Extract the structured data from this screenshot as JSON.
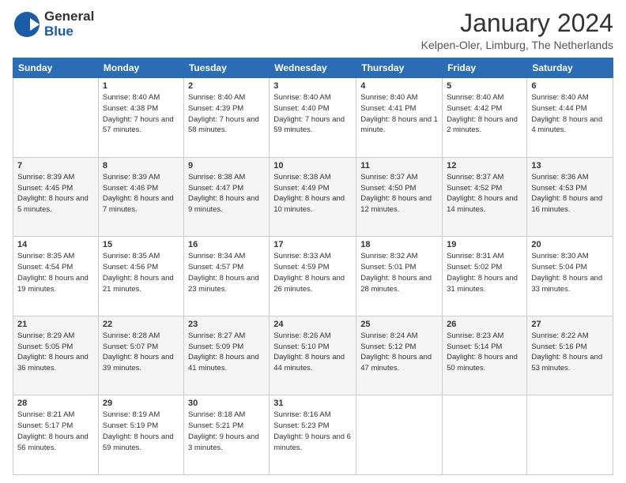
{
  "logo": {
    "general": "General",
    "blue": "Blue"
  },
  "header": {
    "month_year": "January 2024",
    "location": "Kelpen-Oler, Limburg, The Netherlands"
  },
  "columns": [
    "Sunday",
    "Monday",
    "Tuesday",
    "Wednesday",
    "Thursday",
    "Friday",
    "Saturday"
  ],
  "weeks": [
    [
      {
        "day": "",
        "sunrise": "",
        "sunset": "",
        "daylight": ""
      },
      {
        "day": "1",
        "sunrise": "Sunrise: 8:40 AM",
        "sunset": "Sunset: 4:38 PM",
        "daylight": "Daylight: 7 hours and 57 minutes."
      },
      {
        "day": "2",
        "sunrise": "Sunrise: 8:40 AM",
        "sunset": "Sunset: 4:39 PM",
        "daylight": "Daylight: 7 hours and 58 minutes."
      },
      {
        "day": "3",
        "sunrise": "Sunrise: 8:40 AM",
        "sunset": "Sunset: 4:40 PM",
        "daylight": "Daylight: 7 hours and 59 minutes."
      },
      {
        "day": "4",
        "sunrise": "Sunrise: 8:40 AM",
        "sunset": "Sunset: 4:41 PM",
        "daylight": "Daylight: 8 hours and 1 minute."
      },
      {
        "day": "5",
        "sunrise": "Sunrise: 8:40 AM",
        "sunset": "Sunset: 4:42 PM",
        "daylight": "Daylight: 8 hours and 2 minutes."
      },
      {
        "day": "6",
        "sunrise": "Sunrise: 8:40 AM",
        "sunset": "Sunset: 4:44 PM",
        "daylight": "Daylight: 8 hours and 4 minutes."
      }
    ],
    [
      {
        "day": "7",
        "sunrise": "Sunrise: 8:39 AM",
        "sunset": "Sunset: 4:45 PM",
        "daylight": "Daylight: 8 hours and 5 minutes."
      },
      {
        "day": "8",
        "sunrise": "Sunrise: 8:39 AM",
        "sunset": "Sunset: 4:46 PM",
        "daylight": "Daylight: 8 hours and 7 minutes."
      },
      {
        "day": "9",
        "sunrise": "Sunrise: 8:38 AM",
        "sunset": "Sunset: 4:47 PM",
        "daylight": "Daylight: 8 hours and 9 minutes."
      },
      {
        "day": "10",
        "sunrise": "Sunrise: 8:38 AM",
        "sunset": "Sunset: 4:49 PM",
        "daylight": "Daylight: 8 hours and 10 minutes."
      },
      {
        "day": "11",
        "sunrise": "Sunrise: 8:37 AM",
        "sunset": "Sunset: 4:50 PM",
        "daylight": "Daylight: 8 hours and 12 minutes."
      },
      {
        "day": "12",
        "sunrise": "Sunrise: 8:37 AM",
        "sunset": "Sunset: 4:52 PM",
        "daylight": "Daylight: 8 hours and 14 minutes."
      },
      {
        "day": "13",
        "sunrise": "Sunrise: 8:36 AM",
        "sunset": "Sunset: 4:53 PM",
        "daylight": "Daylight: 8 hours and 16 minutes."
      }
    ],
    [
      {
        "day": "14",
        "sunrise": "Sunrise: 8:35 AM",
        "sunset": "Sunset: 4:54 PM",
        "daylight": "Daylight: 8 hours and 19 minutes."
      },
      {
        "day": "15",
        "sunrise": "Sunrise: 8:35 AM",
        "sunset": "Sunset: 4:56 PM",
        "daylight": "Daylight: 8 hours and 21 minutes."
      },
      {
        "day": "16",
        "sunrise": "Sunrise: 8:34 AM",
        "sunset": "Sunset: 4:57 PM",
        "daylight": "Daylight: 8 hours and 23 minutes."
      },
      {
        "day": "17",
        "sunrise": "Sunrise: 8:33 AM",
        "sunset": "Sunset: 4:59 PM",
        "daylight": "Daylight: 8 hours and 26 minutes."
      },
      {
        "day": "18",
        "sunrise": "Sunrise: 8:32 AM",
        "sunset": "Sunset: 5:01 PM",
        "daylight": "Daylight: 8 hours and 28 minutes."
      },
      {
        "day": "19",
        "sunrise": "Sunrise: 8:31 AM",
        "sunset": "Sunset: 5:02 PM",
        "daylight": "Daylight: 8 hours and 31 minutes."
      },
      {
        "day": "20",
        "sunrise": "Sunrise: 8:30 AM",
        "sunset": "Sunset: 5:04 PM",
        "daylight": "Daylight: 8 hours and 33 minutes."
      }
    ],
    [
      {
        "day": "21",
        "sunrise": "Sunrise: 8:29 AM",
        "sunset": "Sunset: 5:05 PM",
        "daylight": "Daylight: 8 hours and 36 minutes."
      },
      {
        "day": "22",
        "sunrise": "Sunrise: 8:28 AM",
        "sunset": "Sunset: 5:07 PM",
        "daylight": "Daylight: 8 hours and 39 minutes."
      },
      {
        "day": "23",
        "sunrise": "Sunrise: 8:27 AM",
        "sunset": "Sunset: 5:09 PM",
        "daylight": "Daylight: 8 hours and 41 minutes."
      },
      {
        "day": "24",
        "sunrise": "Sunrise: 8:26 AM",
        "sunset": "Sunset: 5:10 PM",
        "daylight": "Daylight: 8 hours and 44 minutes."
      },
      {
        "day": "25",
        "sunrise": "Sunrise: 8:24 AM",
        "sunset": "Sunset: 5:12 PM",
        "daylight": "Daylight: 8 hours and 47 minutes."
      },
      {
        "day": "26",
        "sunrise": "Sunrise: 8:23 AM",
        "sunset": "Sunset: 5:14 PM",
        "daylight": "Daylight: 8 hours and 50 minutes."
      },
      {
        "day": "27",
        "sunrise": "Sunrise: 8:22 AM",
        "sunset": "Sunset: 5:16 PM",
        "daylight": "Daylight: 8 hours and 53 minutes."
      }
    ],
    [
      {
        "day": "28",
        "sunrise": "Sunrise: 8:21 AM",
        "sunset": "Sunset: 5:17 PM",
        "daylight": "Daylight: 8 hours and 56 minutes."
      },
      {
        "day": "29",
        "sunrise": "Sunrise: 8:19 AM",
        "sunset": "Sunset: 5:19 PM",
        "daylight": "Daylight: 8 hours and 59 minutes."
      },
      {
        "day": "30",
        "sunrise": "Sunrise: 8:18 AM",
        "sunset": "Sunset: 5:21 PM",
        "daylight": "Daylight: 9 hours and 3 minutes."
      },
      {
        "day": "31",
        "sunrise": "Sunrise: 8:16 AM",
        "sunset": "Sunset: 5:23 PM",
        "daylight": "Daylight: 9 hours and 6 minutes."
      },
      {
        "day": "",
        "sunrise": "",
        "sunset": "",
        "daylight": ""
      },
      {
        "day": "",
        "sunrise": "",
        "sunset": "",
        "daylight": ""
      },
      {
        "day": "",
        "sunrise": "",
        "sunset": "",
        "daylight": ""
      }
    ]
  ]
}
